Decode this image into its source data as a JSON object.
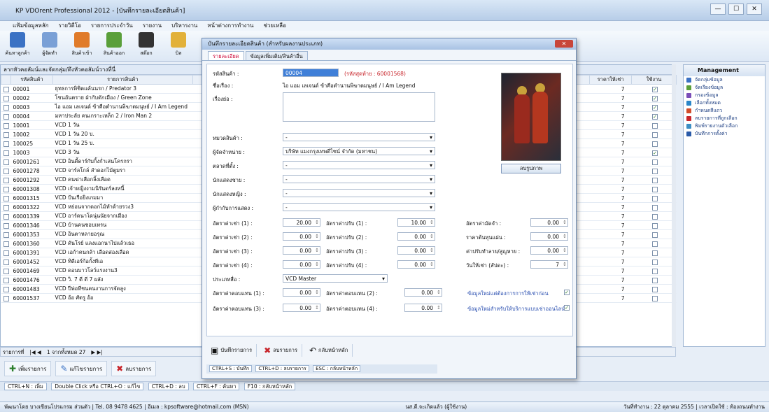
{
  "window": {
    "title": "KP VDOrent Professional 2012 - [บันทึกรายละเอียดสินค้า]",
    "controls": [
      "—",
      "☐",
      "✕"
    ]
  },
  "menu": [
    "แฟ้มข้อมูลหลัก",
    "รายวิดีโอ",
    "รายการประจำวัน",
    "รายงาน",
    "บริหารงาน",
    "หน้าต่างการทำงาน",
    "ช่วยเหลือ"
  ],
  "ribbon": [
    {
      "label": "ค้นหาลูกค้า",
      "color": "#3b72c4"
    },
    {
      "label": "ผู้จัดทำ",
      "color": "#7aa0d6"
    },
    {
      "label": "สินค้าเข้า",
      "color": "#e07b2a"
    },
    {
      "label": "สินค้าออก",
      "color": "#5a9f3a"
    },
    {
      "label": "สต๊อก",
      "color": "#333"
    },
    {
      "label": "บิล",
      "color": "#e2b13a"
    }
  ],
  "list": {
    "header": "ลากหัวคอลัมน์และจัดกลุ่ม/ดึงหัวคอลัมน์วางที่นี่",
    "columns": [
      "รหัสสินค้า",
      "รายการสินค้า",
      "ราคาให้เช่า",
      "ใช้งาน"
    ],
    "rows": [
      {
        "code": "00001",
        "name": "ยุทธการพิชิตแค้นนรก / Predator 3",
        "c": true
      },
      {
        "code": "00002",
        "name": "โซนอันตราย ฝ่ากับดักเมือง / Green Zone",
        "c": true
      },
      {
        "code": "00003",
        "name": "ไอ แอม เลเจนด์ ข้าคือตำนานพิฆาตมนุษย์ / I Am Legend",
        "c": true
      },
      {
        "code": "00004",
        "name": "มหาประลัย คนเกราะเหล็ก 2 / Iron Man 2",
        "c": true
      },
      {
        "code": "10001",
        "name": "VCD 1 วัน",
        "c": false
      },
      {
        "code": "10002",
        "name": "VCD 1 วัน 20 บ.",
        "c": false
      },
      {
        "code": "100025",
        "name": "VCD 1 วัน 25 บ.",
        "c": false
      },
      {
        "code": "10003",
        "name": "VCD 3 วัน",
        "c": true
      },
      {
        "code": "60001261",
        "name": "VCD อินดี้ดาร์กับกิ้งก่ำเล่นโครกรา",
        "c": false
      },
      {
        "code": "60001278",
        "name": "VCD จาร์ลโกล์ ลำดอกไม้ตูมรา",
        "c": false
      },
      {
        "code": "60001292",
        "name": "VCD คนฆ่าเสือกลิ้งเลือด",
        "c": false
      },
      {
        "code": "60001308",
        "name": "VCD เจ้าหญิงงามนิรันดร์ลงหนี้",
        "c": false
      },
      {
        "code": "60001315",
        "name": "VCD ป้นเรือยิงเกมมา",
        "c": false
      },
      {
        "code": "60001322",
        "name": "VCD หย่อนจากดอกไม้ทำด้ายรวง3",
        "c": false
      },
      {
        "code": "60001339",
        "name": "VCD อาร์ดนาโดนุ่นนัยจากเมือง",
        "c": false
      },
      {
        "code": "60001346",
        "name": "VCD บ้านคนชอบเทรน",
        "c": false
      },
      {
        "code": "60001353",
        "name": "VCD อินตาหลายอรุณ",
        "c": false
      },
      {
        "code": "60001360",
        "name": "VCD ดันโรย์ แลงแอกนาไปแล้วเธอ",
        "c": false
      },
      {
        "code": "60001391",
        "name": "VCD เอก้าคนกล้า เลือดสองเลือด",
        "c": false
      },
      {
        "code": "60001452",
        "name": "VCD ทิดีเอร์ก้อกั้งทีเอ",
        "c": false
      },
      {
        "code": "60001469",
        "name": "VCD ดอนบาวโลว์แรงงาน3",
        "c": false
      },
      {
        "code": "60001476",
        "name": "VCD วิ. 7 ดี ดี 7 ผลัง",
        "c": false
      },
      {
        "code": "60001483",
        "name": "VCD ปีพ่อทีชนคนงานการจัดลูง",
        "c": false
      },
      {
        "code": "60001537",
        "name": "VCD อ้อ ศัตรู อ้อ",
        "c": false
      }
    ],
    "price": "7",
    "nav": {
      "label": "รายการที่",
      "current": "1 จากทั้งหมด 27"
    }
  },
  "actions": [
    "เพิ่มรายการ",
    "แก้ไขรายการ",
    "ลบรายการ"
  ],
  "hint": [
    "CTRL+N : เพิ่ม",
    "Double Click หรือ CTRL+O : แก้ไข",
    "CTRL+D : ลบ",
    "CTRL+F : ค้นหา",
    "F10 : กลับหน้าหลัก"
  ],
  "status": {
    "left": "พัฒนาโดย บางเขียนโปรแกรม ส่วนตัว | Tel. 08 9478 4625 | อีเมล : kpsoftware@hotmail.com (MSN)",
    "mid": "นส.ดี.จะเกิดแล้ว (ผู้ใช้งาน)",
    "right": "วันที่ทำงาน : 22 ตุลาคม 2555 | เวลาเปิดใช้ : ท้องถนนทำงาน"
  },
  "management": {
    "title": "Management",
    "items": [
      {
        "label": "จัดกลุ่มข้อมูล",
        "color": "#3b72c4"
      },
      {
        "label": "จัดเรียงข้อมูล",
        "color": "#5a9f3a"
      },
      {
        "label": "กรองข้อมูล",
        "color": "#7a4db8"
      },
      {
        "label": "เลือกทั้งหมด",
        "color": "#2a86c9"
      },
      {
        "label": "กำหนดสีแถว",
        "color": "#d24c2a"
      },
      {
        "label": "ลบรายการที่ถูกเลือก",
        "color": "#c8262c"
      },
      {
        "label": "พิมพ์รายงานตัวเลือก",
        "color": "#3b8ec4"
      },
      {
        "label": "บันทึกการตั้งค่า",
        "color": "#2a5aa8"
      }
    ]
  },
  "dialog": {
    "title": "บันทึกรายละเอียดสินค้า (สำหรับผลงานประเภท)",
    "tabs": [
      "รายละเอียด",
      "ข้อมูลเพิ่มเติม/สินค้าอื่น"
    ],
    "code_label": "รหัสสินค้า :",
    "code_value": "00004",
    "code_hint": "(รหัสสุดท้าย : 60001568)",
    "name_label": "ชื่อเรื่อง :",
    "name_value": "ไอ แอม เลเจนด์ ข้าคือตำนานพิฆาตมนุษย์ / I Am Legend",
    "desc_label": "เรื่องย่อ :",
    "category_label": "หมวดสินค้า :",
    "category_value": "-",
    "vendor_label": "ผู้จัดจำหน่าย :",
    "vendor_value": "บริษัท แมงกรุงเทพดีไซน์ จำกัด (มหาชน)",
    "type_label": "ตลาดที่ตั้ง :",
    "type_value": "-",
    "actor1_label": "นักแสดงชาย :",
    "actor1_value": "-",
    "actor2_label": "นักแสดงหญิง :",
    "actor2_value": "-",
    "director_label": "ผู้กำกับการแสดง :",
    "director_value": "-",
    "rent": [
      {
        "l1": "อัตราค่าเช่า (1) :",
        "v1": "20.00",
        "l2": "อัตราค่าปรับ (1) :",
        "v2": "10.00"
      },
      {
        "l1": "อัตราค่าเช่า (2) :",
        "v1": "0.00",
        "l2": "อัตราค่าปรับ (2) :",
        "v2": "0.00"
      },
      {
        "l1": "อัตราค่าเช่า (3) :",
        "v1": "0.00",
        "l2": "อัตราค่าปรับ (3) :",
        "v2": "0.00"
      },
      {
        "l1": "อัตราค่าเช่า (4) :",
        "v1": "0.00",
        "l2": "อัตราค่าปรับ (4) :",
        "v2": "0.00"
      }
    ],
    "right": [
      {
        "label": "อัตราค่ามัดจำ :",
        "value": "0.00"
      },
      {
        "label": "ราคาต้นทุนแผ่น :",
        "value": "0.00"
      },
      {
        "label": "ค่าปรับทำลาย/สูญหาย :",
        "value": "0.00"
      },
      {
        "label": "วันให้เช่า (สัปดะ) :",
        "value": "7"
      }
    ],
    "media_label": "ประเภทสื่อ :",
    "media_value": "VCD Master",
    "pen": [
      {
        "l1": "อัตราค่าตอบแทน (1) :",
        "v1": "0.00",
        "l2": "อัตราค่าตอบแทน (2) :",
        "v2": "0.00"
      },
      {
        "l1": "อัตราค่าตอบแทน (3) :",
        "v1": "0.00",
        "l2": "อัตราค่าตอบแทน (4) :",
        "v2": "0.00"
      }
    ],
    "check1": "ข้อมูลใหม่แต่ต้องการการให้เช่าก่อน",
    "check2": "ข้อมูลใหม่สำหรับให้บริการแบบเช่าออนไลน์",
    "delete_img": "ลบรูปภาพ",
    "buttons": [
      "บันทึกรายการ",
      "ลบรายการ",
      "กลับหน้าหลัก"
    ],
    "hint": [
      "CTRL+S : บันทึก",
      "CTRL+D : ลบรายการ",
      "ESC : กลับหน้าหลัก"
    ]
  }
}
